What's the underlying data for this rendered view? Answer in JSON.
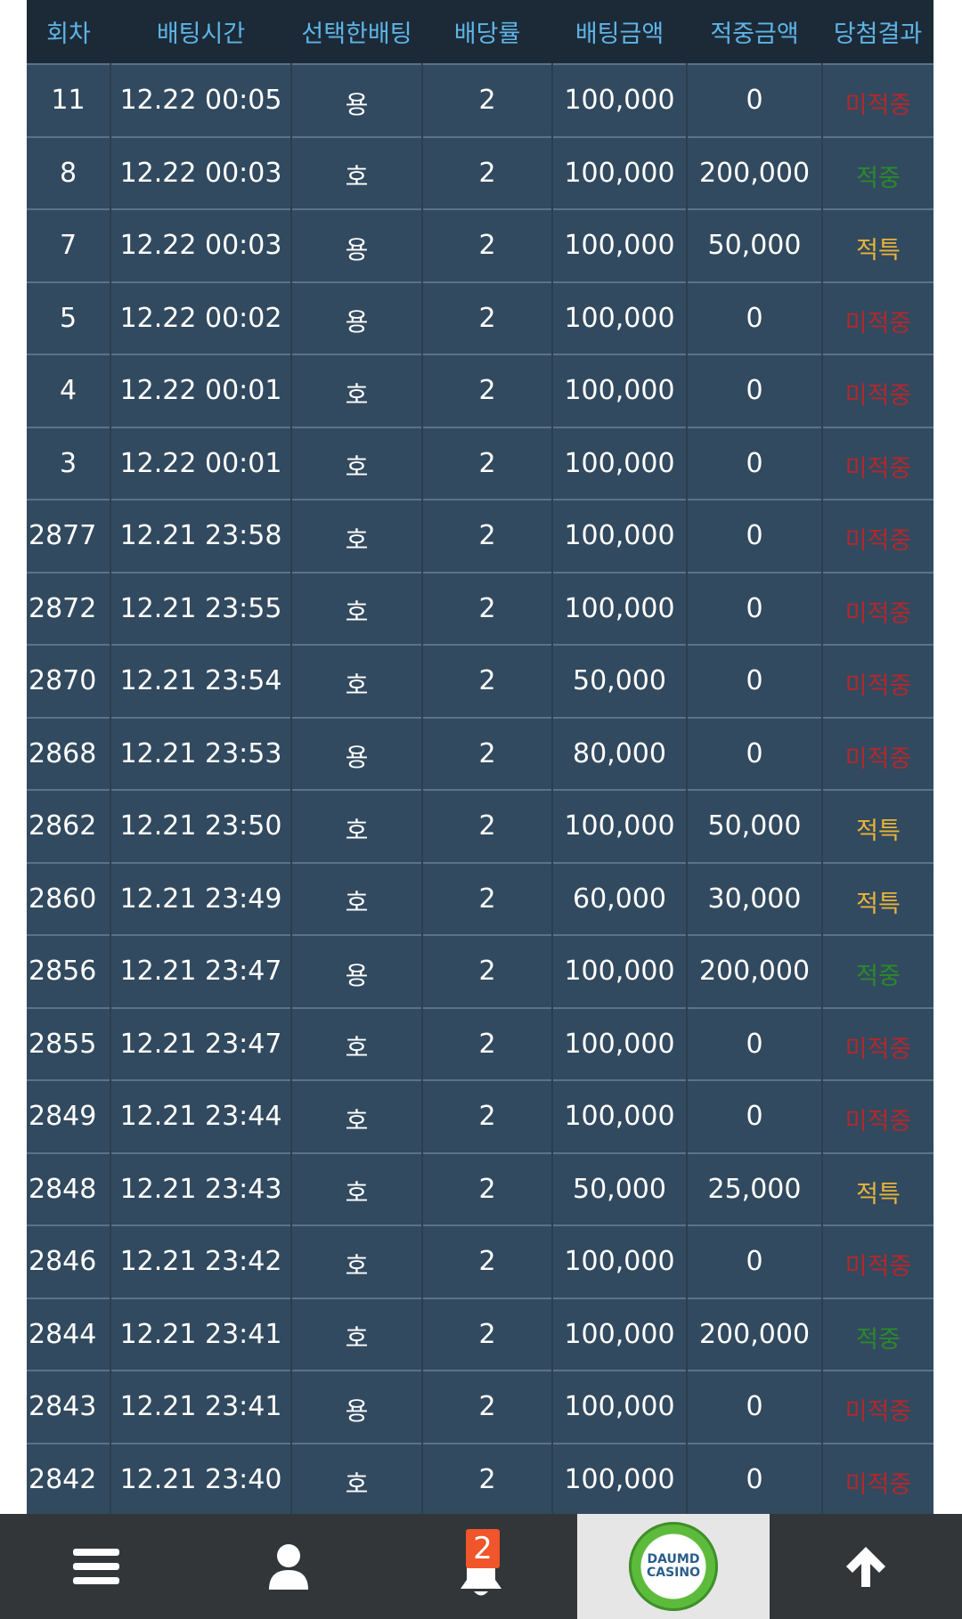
{
  "table": {
    "headers": {
      "round": "회차",
      "bet_time": "배팅시간",
      "chosen_bet": "선택한배팅",
      "odds": "배당률",
      "bet_amount": "배팅금액",
      "win_amount": "적중금액",
      "result": "당첨결과"
    },
    "rows": [
      {
        "round": "11",
        "time": "12.22 00:05",
        "choice": "용",
        "odds": "2",
        "amount": "100,000",
        "win": "0",
        "result": "미적중",
        "status": "miss"
      },
      {
        "round": "8",
        "time": "12.22 00:03",
        "choice": "호",
        "odds": "2",
        "amount": "100,000",
        "win": "200,000",
        "result": "적중",
        "status": "hit"
      },
      {
        "round": "7",
        "time": "12.22 00:03",
        "choice": "용",
        "odds": "2",
        "amount": "100,000",
        "win": "50,000",
        "result": "적특",
        "status": "special"
      },
      {
        "round": "5",
        "time": "12.22 00:02",
        "choice": "용",
        "odds": "2",
        "amount": "100,000",
        "win": "0",
        "result": "미적중",
        "status": "miss"
      },
      {
        "round": "4",
        "time": "12.22 00:01",
        "choice": "호",
        "odds": "2",
        "amount": "100,000",
        "win": "0",
        "result": "미적중",
        "status": "miss"
      },
      {
        "round": "3",
        "time": "12.22 00:01",
        "choice": "호",
        "odds": "2",
        "amount": "100,000",
        "win": "0",
        "result": "미적중",
        "status": "miss"
      },
      {
        "round": "2877",
        "time": "12.21 23:58",
        "choice": "호",
        "odds": "2",
        "amount": "100,000",
        "win": "0",
        "result": "미적중",
        "status": "miss"
      },
      {
        "round": "2872",
        "time": "12.21 23:55",
        "choice": "호",
        "odds": "2",
        "amount": "100,000",
        "win": "0",
        "result": "미적중",
        "status": "miss"
      },
      {
        "round": "2870",
        "time": "12.21 23:54",
        "choice": "호",
        "odds": "2",
        "amount": "50,000",
        "win": "0",
        "result": "미적중",
        "status": "miss"
      },
      {
        "round": "2868",
        "time": "12.21 23:53",
        "choice": "용",
        "odds": "2",
        "amount": "80,000",
        "win": "0",
        "result": "미적중",
        "status": "miss"
      },
      {
        "round": "2862",
        "time": "12.21 23:50",
        "choice": "호",
        "odds": "2",
        "amount": "100,000",
        "win": "50,000",
        "result": "적특",
        "status": "special"
      },
      {
        "round": "2860",
        "time": "12.21 23:49",
        "choice": "호",
        "odds": "2",
        "amount": "60,000",
        "win": "30,000",
        "result": "적특",
        "status": "special"
      },
      {
        "round": "2856",
        "time": "12.21 23:47",
        "choice": "용",
        "odds": "2",
        "amount": "100,000",
        "win": "200,000",
        "result": "적중",
        "status": "hit"
      },
      {
        "round": "2855",
        "time": "12.21 23:47",
        "choice": "호",
        "odds": "2",
        "amount": "100,000",
        "win": "0",
        "result": "미적중",
        "status": "miss"
      },
      {
        "round": "2849",
        "time": "12.21 23:44",
        "choice": "호",
        "odds": "2",
        "amount": "100,000",
        "win": "0",
        "result": "미적중",
        "status": "miss"
      },
      {
        "round": "2848",
        "time": "12.21 23:43",
        "choice": "호",
        "odds": "2",
        "amount": "50,000",
        "win": "25,000",
        "result": "적특",
        "status": "special"
      },
      {
        "round": "2846",
        "time": "12.21 23:42",
        "choice": "호",
        "odds": "2",
        "amount": "100,000",
        "win": "0",
        "result": "미적중",
        "status": "miss"
      },
      {
        "round": "2844",
        "time": "12.21 23:41",
        "choice": "호",
        "odds": "2",
        "amount": "100,000",
        "win": "200,000",
        "result": "적중",
        "status": "hit"
      },
      {
        "round": "2843",
        "time": "12.21 23:41",
        "choice": "용",
        "odds": "2",
        "amount": "100,000",
        "win": "0",
        "result": "미적중",
        "status": "miss"
      },
      {
        "round": "2842",
        "time": "12.21 23:40",
        "choice": "호",
        "odds": "2",
        "amount": "100,000",
        "win": "0",
        "result": "미적중",
        "status": "miss"
      }
    ]
  },
  "bottom_nav": {
    "items": [
      {
        "icon": "menu-icon"
      },
      {
        "icon": "user-icon"
      },
      {
        "icon": "bell-icon",
        "badge": "2"
      },
      {
        "icon": "daumd-casino-logo",
        "logo_text": [
          "DAUMD",
          "CASINO"
        ]
      },
      {
        "icon": "arrow-up-icon"
      }
    ]
  },
  "colors": {
    "header_bg": "#1c2a37",
    "header_text": "#5fb4e6",
    "row_bg": "#324a5f",
    "miss": "#b2282c",
    "hit": "#2a8a2a",
    "special": "#e9b43a",
    "nav_bg": "#323639",
    "badge": "#f0552b"
  }
}
